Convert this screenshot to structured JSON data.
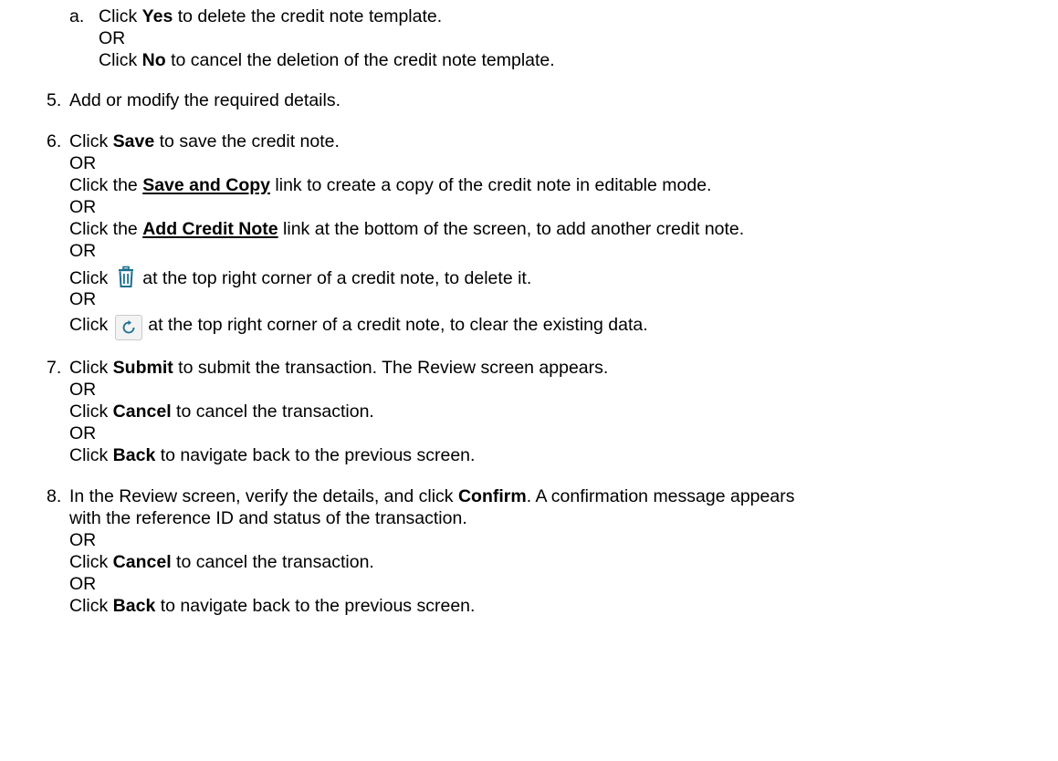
{
  "step_a": {
    "marker": "a.",
    "l1_pre": "Click ",
    "l1_bold": "Yes",
    "l1_post": " to delete the credit note template.",
    "or": "OR",
    "l3_pre": "Click ",
    "l3_bold": "No",
    "l3_post": " to cancel the deletion of the credit note template."
  },
  "step5": {
    "marker": "5.",
    "text": "Add or modify the required details."
  },
  "step6": {
    "marker": "6.",
    "l1_pre": "Click ",
    "l1_bold": "Save",
    "l1_post": " to save the credit note.",
    "or1": "OR",
    "l2_pre": "Click the ",
    "l2_link": "Save and Copy",
    "l2_post": " link to create a copy of the credit note in editable mode.",
    "or2": "OR",
    "l3_pre": "Click the ",
    "l3_link": "Add Credit Note",
    "l3_post": " link at the bottom of the screen, to add another credit note.",
    "or3": "OR",
    "l4_pre": "Click",
    "l4_icon": "delete-trash-icon",
    "l4_post": "at the top right corner of a credit note, to delete it.",
    "or4": "OR",
    "l5_pre": "Click",
    "l5_icon": "refresh-icon",
    "l5_post": "at the top right corner of a credit note, to clear the existing data."
  },
  "step7": {
    "marker": "7.",
    "l1_pre": "Click ",
    "l1_bold": "Submit",
    "l1_post": " to submit the transaction. The Review screen appears.",
    "or1": "OR",
    "l2_pre": "Click ",
    "l2_bold": "Cancel",
    "l2_post": " to cancel the transaction.",
    "or2": "OR",
    "l3_pre": "Click ",
    "l3_bold": "Back",
    "l3_post": " to navigate back to the previous screen."
  },
  "step8": {
    "marker": "8.",
    "l1_pre": "In the Review screen, verify the details, and click ",
    "l1_bold": "Confirm",
    "l1_post": ". A confirmation message appears",
    "l1b": "with the reference ID and status of the transaction.",
    "or1": "OR",
    "l2_pre": "Click ",
    "l2_bold": "Cancel",
    "l2_post": " to cancel the transaction.",
    "or2": "OR",
    "l3_pre": "Click ",
    "l3_bold": "Back",
    "l3_post": " to navigate back to the previous screen."
  },
  "colors": {
    "text": "#000000",
    "icon_teal": "#1b6f8f"
  }
}
